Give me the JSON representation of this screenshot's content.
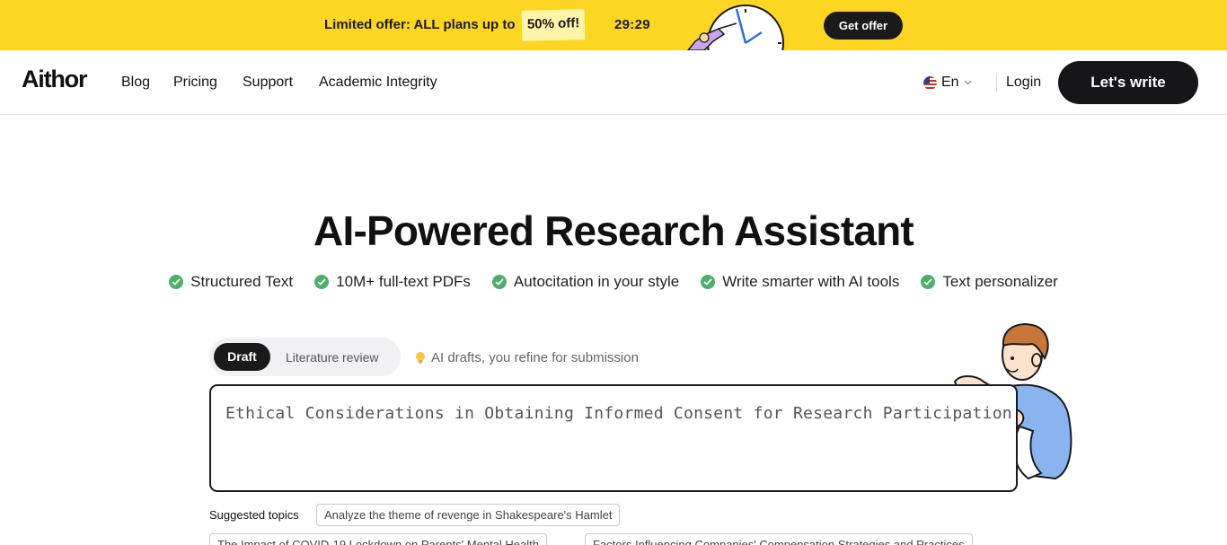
{
  "banner": {
    "offer_text": "Limited offer: ALL plans up to",
    "badge": "50% off!",
    "timer": "29:29",
    "cta": "Get offer",
    "colors": {
      "background": "#fdd523",
      "badge": "#fff5a8"
    },
    "illustration": "clock-icon"
  },
  "nav": {
    "logo": "Aithor",
    "links": [
      "Blog",
      "Pricing",
      "Support",
      "Academic Integrity"
    ],
    "language": "En",
    "language_icon": "us-flag-icon",
    "login": "Login",
    "primary_cta": "Let's write"
  },
  "hero": {
    "title": "AI-Powered Research Assistant",
    "features": [
      "Structured Text",
      "10M+ full-text PDFs",
      "Autocitation in your style",
      "Write smarter with AI tools",
      "Text personalizer"
    ],
    "feature_icon": "check-circle-icon",
    "accent_color": "#4caf6a"
  },
  "mode": {
    "tabs": [
      "Draft",
      "Literature review"
    ],
    "selected": "Draft",
    "hint": "AI drafts, you refine for submission",
    "hint_icon": "lightbulb-icon"
  },
  "prompt": {
    "value": "Ethical Considerations in Obtaining Informed Consent for Research Participation"
  },
  "suggestions": {
    "label": "Suggested topics",
    "topics": [
      "Analyze the theme of revenge in Shakespeare's Hamlet",
      "The Impact of COVID-19 Lockdown on Parents' Mental Health",
      "Factors Influencing Companies' Compensation Strategies and Practices"
    ]
  }
}
